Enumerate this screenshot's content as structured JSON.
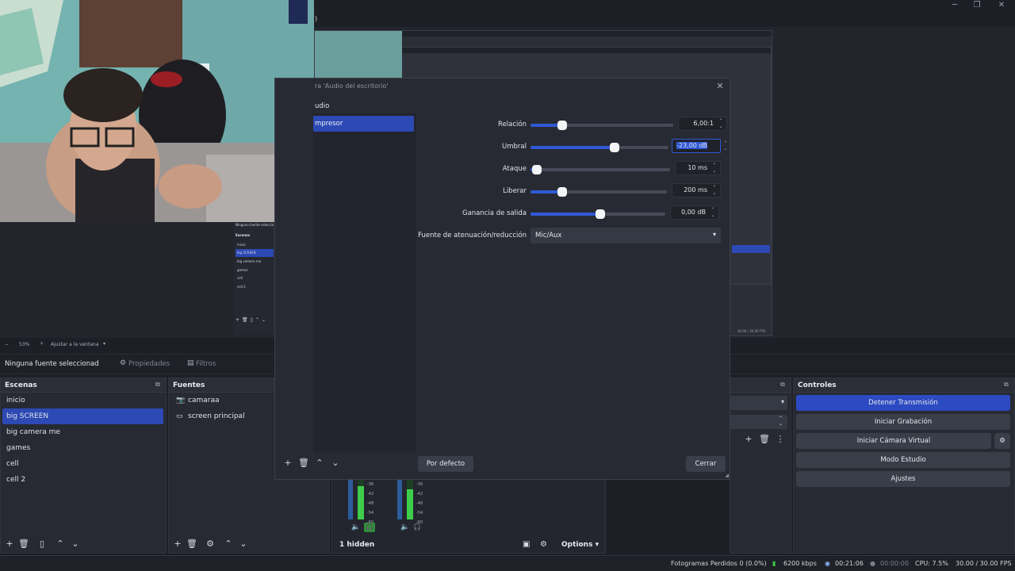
{
  "window": {
    "partial_title": ")"
  },
  "preview": {
    "zoom_level": "53%",
    "fit_label": "Ajustar a la ventana",
    "mini_scenes": {
      "header": "Ninguna fuente seleccio",
      "title": "Escenas",
      "items": [
        "inicio",
        "big SCREEN",
        "big camera me",
        "games",
        "cell",
        "cell 2"
      ],
      "selected_index": 1
    },
    "fps_mini": "30.00 / 30.00 FPS"
  },
  "properties_bar": {
    "no_source": "Ninguna fuente seleccionad",
    "properties_label": "Propiedades",
    "filters_label": "Filtros"
  },
  "scenes": {
    "title": "Escenas",
    "items": [
      "inicio",
      "big SCREEN",
      "big camera me",
      "games",
      "cell",
      "cell 2"
    ],
    "selected_index": 1
  },
  "sources": {
    "title": "Fuentes",
    "items": [
      {
        "label": "camaraa",
        "icon": "camera-icon"
      },
      {
        "label": "screen principal",
        "icon": "monitor-icon"
      }
    ]
  },
  "controls": {
    "title": "Controles",
    "buttons": [
      "Detener Transmisión",
      "Iniciar Grabación",
      "Iniciar Cámara Virtual",
      "Modo Estudio",
      "Ajustes"
    ]
  },
  "dialog": {
    "title": "ra 'Audio del escritorio'",
    "section": "udio",
    "filter_item": "mpresor",
    "params": [
      {
        "label": "Relación",
        "value": "6,00:1",
        "level": 0.22
      },
      {
        "label": "Umbral",
        "value": "-23,00 dB",
        "level": 0.6
      },
      {
        "label": "Ataque",
        "value": "10 ms",
        "level": 0.05
      },
      {
        "label": "Liberar",
        "value": "200 ms",
        "level": 0.22
      },
      {
        "label": "Ganancia de salida",
        "value": "0,00 dB",
        "level": 0.5
      }
    ],
    "duck_label": "Fuente de atenuación/reducción",
    "duck_value": "Mic/Aux",
    "defaults_button": "Por defecto",
    "close_button": "Cerrar"
  },
  "mixer": {
    "hidden_label": "1 hidden",
    "options_label": "Options",
    "scale": [
      "-36",
      "-42",
      "-48",
      "-54",
      "-60"
    ]
  },
  "status": {
    "dropped_frames": "Fotogramas Perdidos 0 (0.0%)",
    "bitrate": "6200 kbps",
    "stream_time": "00:21:06",
    "rec_time": "00:00:00",
    "cpu": "CPU: 7.5%",
    "fps": "30.00 / 30.00 FPS"
  },
  "colors": {
    "accent": "#2c49b4",
    "panel": "#272a33",
    "live": "#3dcd4a"
  }
}
